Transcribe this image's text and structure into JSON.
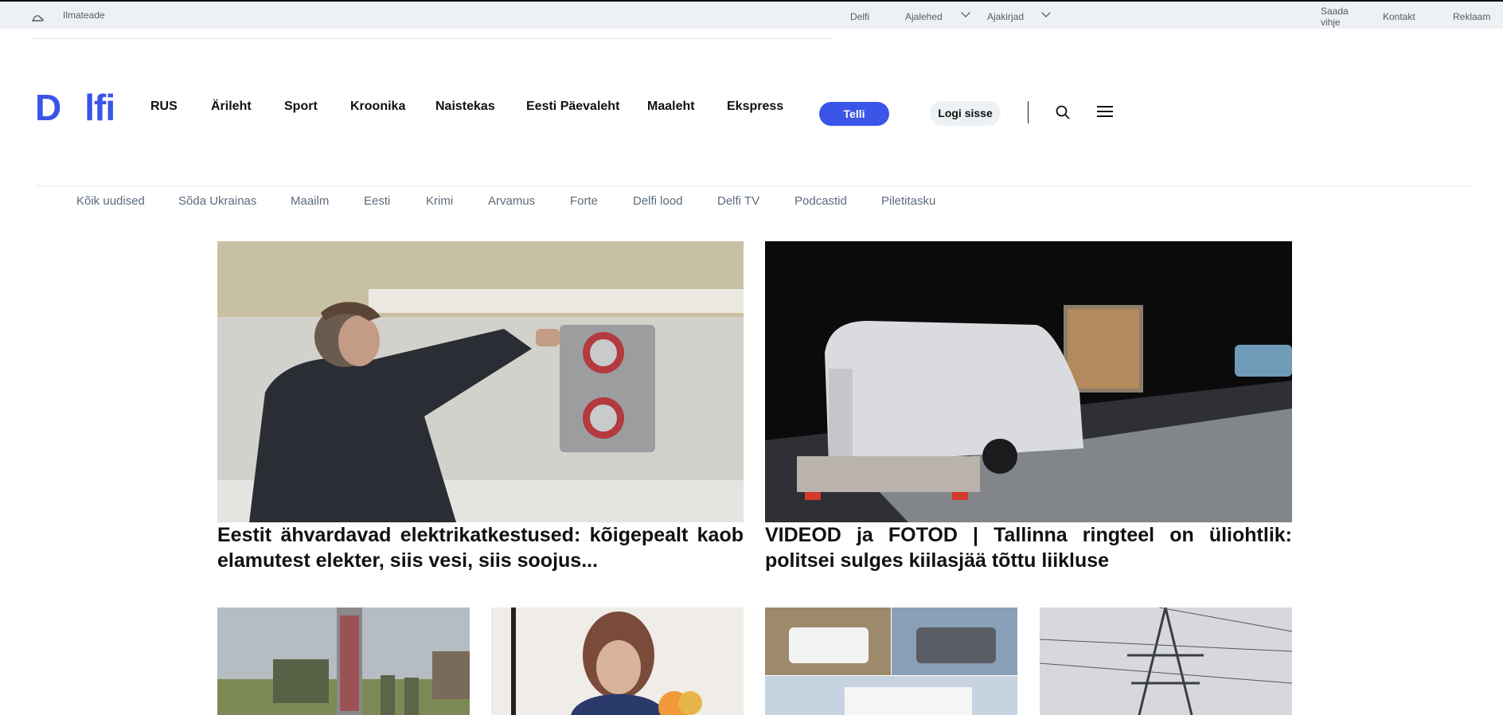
{
  "topbar": {
    "weather_label": "Ilmateade",
    "delfi": "Delfi",
    "ajalehed": "Ajalehed",
    "ajakirjad": "Ajakirjad",
    "saada_line1": "Saada",
    "saada_line2": "vihje",
    "kontakt": "Kontakt",
    "reklaam": "Reklaam"
  },
  "header": {
    "logo_left": "D",
    "logo_right": "lfi",
    "nav": [
      "RUS",
      "Ärileht",
      "Sport",
      "Kroonika",
      "Naistekas",
      "Eesti Päevaleht",
      "Maaleht",
      "Ekspress"
    ],
    "subscribe_label": "Telli",
    "login_label": "Logi sisse",
    "accent_color": "#3a55e8"
  },
  "sections": [
    "Kõik uudised",
    "Sõda Ukrainas",
    "Maailm",
    "Eesti",
    "Krimi",
    "Arvamus",
    "Forte",
    "Delfi lood",
    "Delfi TV",
    "Podcastid",
    "Piletitasku"
  ],
  "articles": [
    {
      "headline": "Eestit ähvardavad elektrikatkestused: kõigepealt kaob elamutest elekter, siis vesi, siis soojus..."
    },
    {
      "headline": "VIDEOD ja FOTOD | Tallinna ringteel on üliohtlik: politsei sulges kiilasjää tõttu liikluse"
    }
  ]
}
